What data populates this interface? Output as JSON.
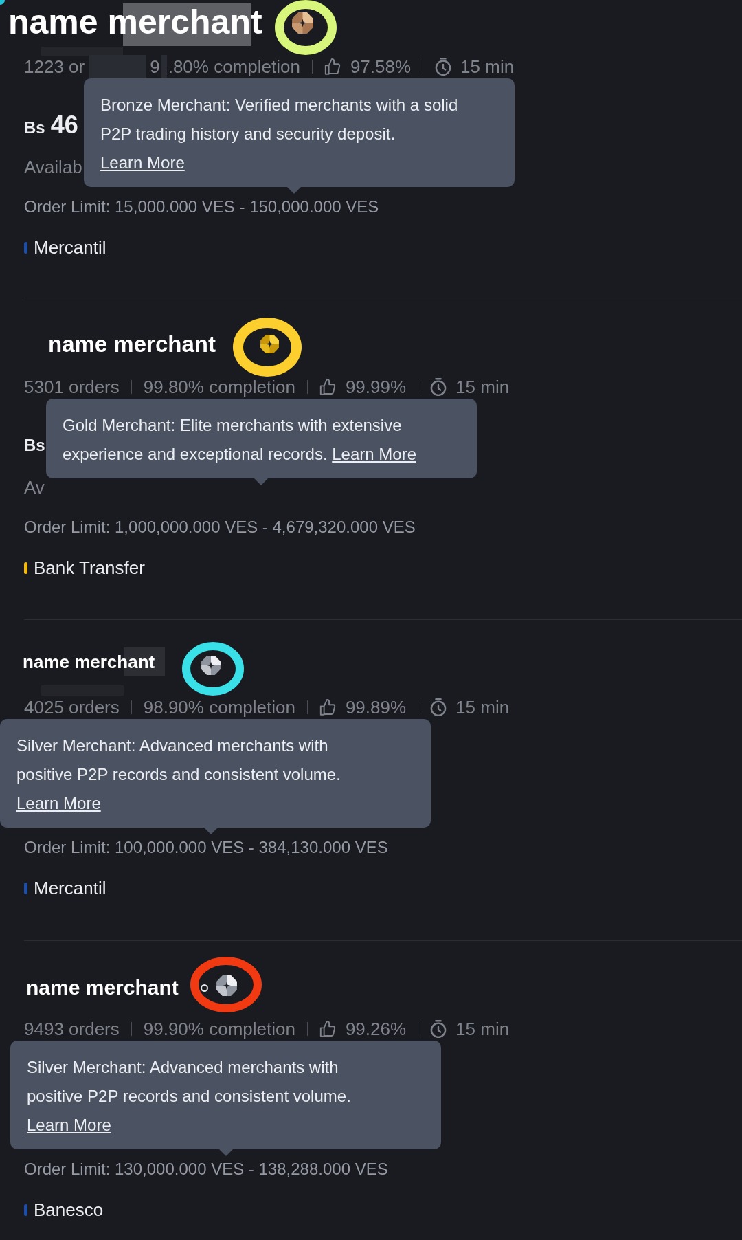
{
  "cards": [
    {
      "name": "name merchant",
      "badge": {
        "kind": "bronze"
      },
      "ring": {
        "color": "#d8f67c"
      },
      "redacted": true,
      "marker": false,
      "stats": [
        {
          "kind": "text",
          "text": "1223 or"
        },
        {
          "kind": "redaction"
        },
        {
          "kind": "text",
          "text": "9"
        },
        {
          "kind": "redaction"
        },
        {
          "kind": "text",
          "text": ".80% completion"
        },
        {
          "kind": "divider"
        },
        {
          "kind": "rate",
          "text": "97.58%"
        },
        {
          "kind": "divider"
        },
        {
          "kind": "time",
          "text": "15 min"
        }
      ],
      "price": {
        "currency": "Bs",
        "amount": "46"
      },
      "available": "Availab",
      "order_limit": "Order Limit: 15,000.000 VES - 150,000.000 VES",
      "payment": {
        "label": "Mercantil",
        "color": "#1e4fa6"
      },
      "tooltip": {
        "text": "Bronze Merchant: Verified merchants with a solid P2P trading history and security deposit.",
        "link": "Learn More"
      }
    },
    {
      "name": "name merchant",
      "badge": {
        "kind": "gold"
      },
      "ring": {
        "color": "#fccf2f"
      },
      "redacted": false,
      "marker": false,
      "stats": [
        {
          "kind": "text",
          "text": "5301 orders"
        },
        {
          "kind": "divider"
        },
        {
          "kind": "text",
          "text": "99.80% completion"
        },
        {
          "kind": "divider"
        },
        {
          "kind": "rate",
          "text": "99.99%"
        },
        {
          "kind": "divider"
        },
        {
          "kind": "time",
          "text": "15 min"
        }
      ],
      "price": {
        "currency": "Bs"
      },
      "available": "Av",
      "order_limit": "Order Limit: 1,000,000.000 VES - 4,679,320.000 VES",
      "payment": {
        "label": "Bank Transfer",
        "color": "#f0b90b"
      },
      "tooltip": {
        "text": "Gold Merchant: Elite merchants with extensive experience and exceptional records.",
        "link": "Learn More"
      }
    },
    {
      "name": "name merchant",
      "badge": {
        "kind": "silver"
      },
      "ring": {
        "color": "#3ae0e8"
      },
      "redacted": true,
      "marker": false,
      "stats": [
        {
          "kind": "text",
          "text": "4025 orders"
        },
        {
          "kind": "divider"
        },
        {
          "kind": "text",
          "text": "98.90% completion"
        },
        {
          "kind": "divider"
        },
        {
          "kind": "rate",
          "text": "99.89%"
        },
        {
          "kind": "divider"
        },
        {
          "kind": "time",
          "text": "15 min"
        }
      ],
      "order_limit": "Order Limit: 100,000.000 VES - 384,130.000 VES",
      "payment": {
        "label": "Mercantil",
        "color": "#1e4fa6"
      },
      "tooltip": {
        "text": "Silver Merchant: Advanced merchants with positive P2P records and consistent volume.",
        "link": "Learn More"
      }
    },
    {
      "name": "name merchant",
      "badge": {
        "kind": "silver"
      },
      "ring": {
        "color": "#f23a12"
      },
      "redacted": false,
      "marker": true,
      "stats": [
        {
          "kind": "text",
          "text": "9493 orders"
        },
        {
          "kind": "divider"
        },
        {
          "kind": "text",
          "text": "99.90% completion"
        },
        {
          "kind": "divider"
        },
        {
          "kind": "rate",
          "text": "99.26%"
        },
        {
          "kind": "divider"
        },
        {
          "kind": "time",
          "text": "15 min"
        }
      ],
      "order_limit": "Order Limit: 130,000.000 VES - 138,288.000 VES",
      "payment": {
        "label": "Banesco",
        "color": "#1e4fa6"
      },
      "tooltip": {
        "text": "Silver Merchant: Advanced merchants with positive P2P records and consistent volume.",
        "link": "Learn More"
      }
    }
  ]
}
